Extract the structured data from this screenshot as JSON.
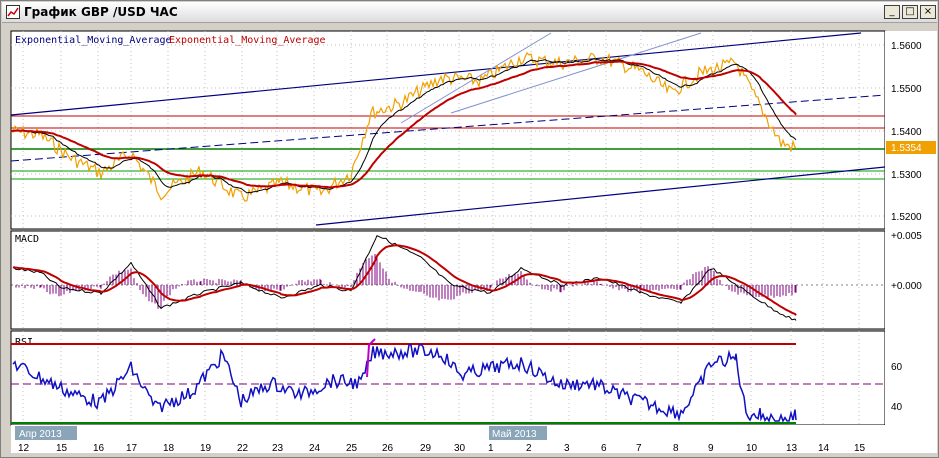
{
  "window": {
    "title": "График GBP /USD  ЧАС",
    "buttons": [
      "_",
      "□",
      "×"
    ]
  },
  "legend": {
    "ema1": "Exponential_Moving_Average",
    "ema2": "Exponential_Moving_Average"
  },
  "colors": {
    "price": "#f0a000",
    "ema_fast": "#000000",
    "ema_slow": "#c00000",
    "channel": "#0a0a80",
    "support_green": "#008000",
    "resist_red": "#c00000",
    "rsi": "#1010c0",
    "rsi_high": "#c00000",
    "rsi_low": "#008000",
    "macd_hist": "#800080",
    "last_price_bg": "#f0a000"
  },
  "price_axis": {
    "ticks": [
      "1.5600",
      "1.5500",
      "1.5400",
      "1.5300",
      "1.5200"
    ],
    "last_price": "1.5354"
  },
  "macd": {
    "label": "MACD",
    "ticks": [
      "+0.005",
      "+0.000"
    ]
  },
  "rsi": {
    "label": "RSI",
    "ticks": [
      "60",
      "50",
      "40"
    ]
  },
  "time_axis": {
    "labels": [
      "12",
      "15",
      "16",
      "17",
      "18",
      "19",
      "22",
      "23",
      "24",
      "25",
      "26",
      "29",
      "30",
      "1",
      "2",
      "3",
      "6",
      "7",
      "8",
      "9",
      "10",
      "13",
      "14",
      "15"
    ],
    "months": [
      "Апр 2013",
      "Май 2013"
    ]
  }
}
